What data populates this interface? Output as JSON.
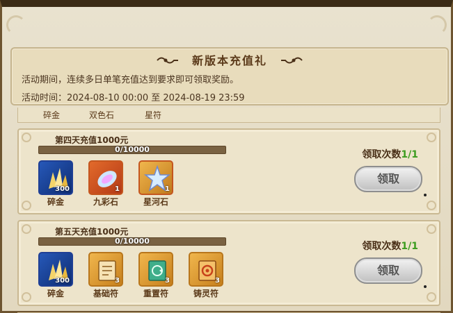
{
  "header": {
    "title": "新版本充值礼",
    "description": "活动期间，连续多日单笔充值达到要求即可领取奖励。",
    "time_label": "活动时间：2024-08-10 00:00 至 2024-08-19 23:59"
  },
  "prev_strip": {
    "items": [
      "碎金",
      "双色石",
      "星符"
    ]
  },
  "cards": [
    {
      "title": "第四天充值1000元",
      "progress_text": "0/10000",
      "progress_fraction": 0,
      "claims_label": "领取次数",
      "claims_count": "1/1",
      "button_label": "领取",
      "items": [
        {
          "name": "碎金",
          "qty": "300",
          "icon": "gold-crystal-icon"
        },
        {
          "name": "九彩石",
          "qty": "1",
          "icon": "rainbow-stone-icon"
        },
        {
          "name": "星河石",
          "qty": "1",
          "icon": "star-crystal-icon"
        }
      ]
    },
    {
      "title": "第五天充值1000元",
      "progress_text": "0/10000",
      "progress_fraction": 0,
      "claims_label": "领取次数",
      "claims_count": "1/1",
      "button_label": "领取",
      "items": [
        {
          "name": "碎金",
          "qty": "300",
          "icon": "gold-crystal-icon"
        },
        {
          "name": "基础符",
          "qty": "3",
          "icon": "scroll-icon"
        },
        {
          "name": "重置符",
          "qty": "3",
          "icon": "reset-scroll-icon"
        },
        {
          "name": "铸灵符",
          "qty": "3",
          "icon": "soul-scroll-icon"
        }
      ]
    }
  ]
}
